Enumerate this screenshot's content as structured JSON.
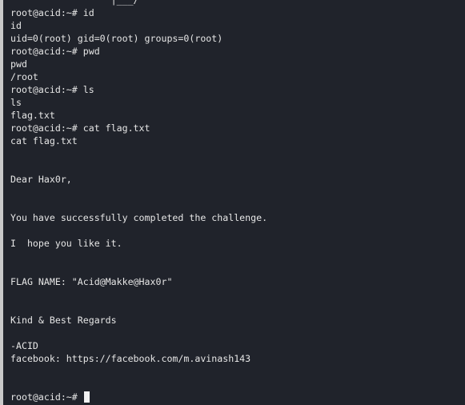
{
  "terminal": {
    "lines": [
      "                  |___/",
      "root@acid:~# id",
      "id",
      "uid=0(root) gid=0(root) groups=0(root)",
      "root@acid:~# pwd",
      "pwd",
      "/root",
      "root@acid:~# ls",
      "ls",
      "flag.txt",
      "root@acid:~# cat flag.txt",
      "cat flag.txt",
      "",
      "",
      "Dear Hax0r,",
      "",
      "",
      "You have successfully completed the challenge.",
      "",
      "I  hope you like it.",
      "",
      "",
      "FLAG NAME: \"Acid@Makke@Hax0r\"",
      "",
      "",
      "Kind & Best Regards",
      "",
      "-ACID",
      "facebook: https://facebook.com/m.avinash143",
      "",
      ""
    ],
    "prompt": "root@acid:~# "
  },
  "colors": {
    "background": "#20232b",
    "text": "#e6e6e6"
  }
}
